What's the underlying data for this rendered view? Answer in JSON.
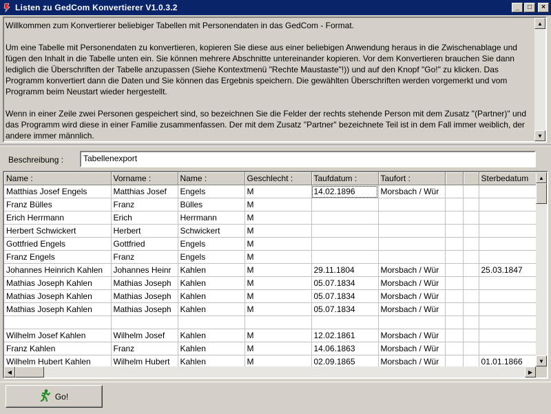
{
  "window": {
    "title": "Listen zu GedCom Konvertierer V1.0.3.2",
    "buttons": [
      "_",
      "□",
      "×"
    ]
  },
  "description": {
    "paragraphs": [
      "Willkommen zum Konvertierer beliebiger Tabellen mit Personendaten in das GedCom - Format.",
      "Um eine Tabelle mit Personendaten zu konvertieren, kopieren Sie diese aus einer beliebigen Anwendung heraus in die Zwischenablage und fügen den Inhalt in die Tabelle unten ein. Sie können mehrere Abschnitte untereinander kopieren. Vor dem Konvertieren brauchen Sie dann lediglich die Überschriften der Tabelle anzupassen (Siehe Kontextmenü \"Rechte Maustaste\"!)) und auf den Knopf \"Go!\" zu klicken. Das Programm konvertiert dann die Daten und Sie können das Ergebnis speichern. Die gewählten Überschriften werden vorgemerkt und vom Programm beim Neustart wieder hergestellt.",
      "Wenn in einer Zeile zwei Personen gespeichert sind, so bezeichnen Sie die Felder der rechts stehende Person mit dem Zusatz \"(Partner)\" und das Programm wird diese in einer Familie zusammenfassen. Der mit dem Zusatz \"Partner\" bezeichnete Teil ist in dem Fall immer weiblich, der andere immer männlich."
    ]
  },
  "beschreibung": {
    "label": "Beschreibung :",
    "value": "Tabellenexport"
  },
  "table": {
    "columns": [
      "Name :",
      "Vorname :",
      "Name :",
      "Geschlecht :",
      "Taufdatum :",
      "Taufort :",
      "",
      "",
      "Sterbedatum"
    ],
    "rows": [
      [
        "Matthias Josef Engels",
        "Matthias Josef",
        "Engels",
        "M",
        "14.02.1896",
        "Morsbach / Wür",
        "",
        "",
        ""
      ],
      [
        "Franz Bülles",
        "Franz",
        "Bülles",
        "M",
        "",
        "",
        "",
        "",
        ""
      ],
      [
        "Erich Herrmann",
        "Erich",
        "Herrmann",
        "M",
        "",
        "",
        "",
        "",
        ""
      ],
      [
        "Herbert Schwickert",
        "Herbert",
        "Schwickert",
        "M",
        "",
        "",
        "",
        "",
        ""
      ],
      [
        "Gottfried Engels",
        "Gottfried",
        "Engels",
        "M",
        "",
        "",
        "",
        "",
        ""
      ],
      [
        "Franz Engels",
        "Franz",
        "Engels",
        "M",
        "",
        "",
        "",
        "",
        ""
      ],
      [
        "Johannes Heinrich Kahlen",
        "Johannes Heinr",
        "Kahlen",
        "M",
        "29.11.1804",
        "Morsbach / Wür",
        "",
        "",
        "25.03.1847"
      ],
      [
        "Mathias Joseph Kahlen",
        "Mathias Joseph",
        "Kahlen",
        "M",
        "05.07.1834",
        "Morsbach / Wür",
        "",
        "",
        ""
      ],
      [
        "Mathias Joseph Kahlen",
        "Mathias Joseph",
        "Kahlen",
        "M",
        "05.07.1834",
        "Morsbach / Wür",
        "",
        "",
        ""
      ],
      [
        "Mathias Joseph Kahlen",
        "Mathias Joseph",
        "Kahlen",
        "M",
        "05.07.1834",
        "Morsbach / Wür",
        "",
        "",
        ""
      ],
      [
        "",
        "",
        "",
        "",
        "",
        "",
        "",
        "",
        ""
      ],
      [
        "Wilhelm Josef Kahlen",
        "Wilhelm Josef",
        "Kahlen",
        "M",
        "12.02.1861",
        "Morsbach / Wür",
        "",
        "",
        ""
      ],
      [
        "Franz Kahlen",
        "Franz",
        "Kahlen",
        "M",
        "14.06.1863",
        "Morsbach / Wür",
        "",
        "",
        ""
      ],
      [
        "Wilhelm Hubert Kahlen",
        "Wilhelm Hubert",
        "Kahlen",
        "M",
        "02.09.1865",
        "Morsbach / Wür",
        "",
        "",
        "01.01.1866"
      ]
    ]
  },
  "go_button": {
    "label": "Go!",
    "icon": "running-man-icon"
  },
  "colors": {
    "titlebar": "#0a246a",
    "face": "#d4d0c8",
    "goicon": "#1f8f1f"
  }
}
